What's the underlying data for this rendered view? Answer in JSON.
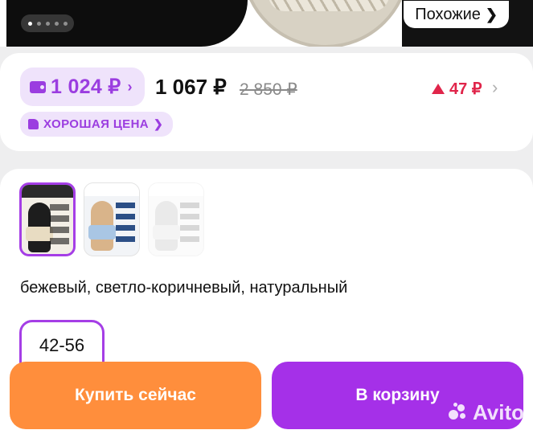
{
  "hero": {
    "similar_label": "Похожие",
    "slide_dots": 5,
    "active_slide": 1
  },
  "price": {
    "wallet_price": "1 024 ₽",
    "main_price": "1 067 ₽",
    "old_price": "2 850 ₽",
    "change": "47 ₽",
    "badge": "ХОРОШАЯ ЦЕНА"
  },
  "options": {
    "variants": [
      "variant-1",
      "variant-2",
      "variant-3"
    ],
    "selected_variant": 1,
    "colors_text": "бежевый, светло-коричневый, натуральный",
    "size": "42-56"
  },
  "actions": {
    "buy_now": "Купить сейчас",
    "add_to_cart": "В корзину"
  },
  "watermark": "Avito",
  "colors": {
    "accent": "#9b3de0",
    "buy": "#ff8e3c",
    "cart": "#a530e8",
    "drop": "#e0254a"
  }
}
